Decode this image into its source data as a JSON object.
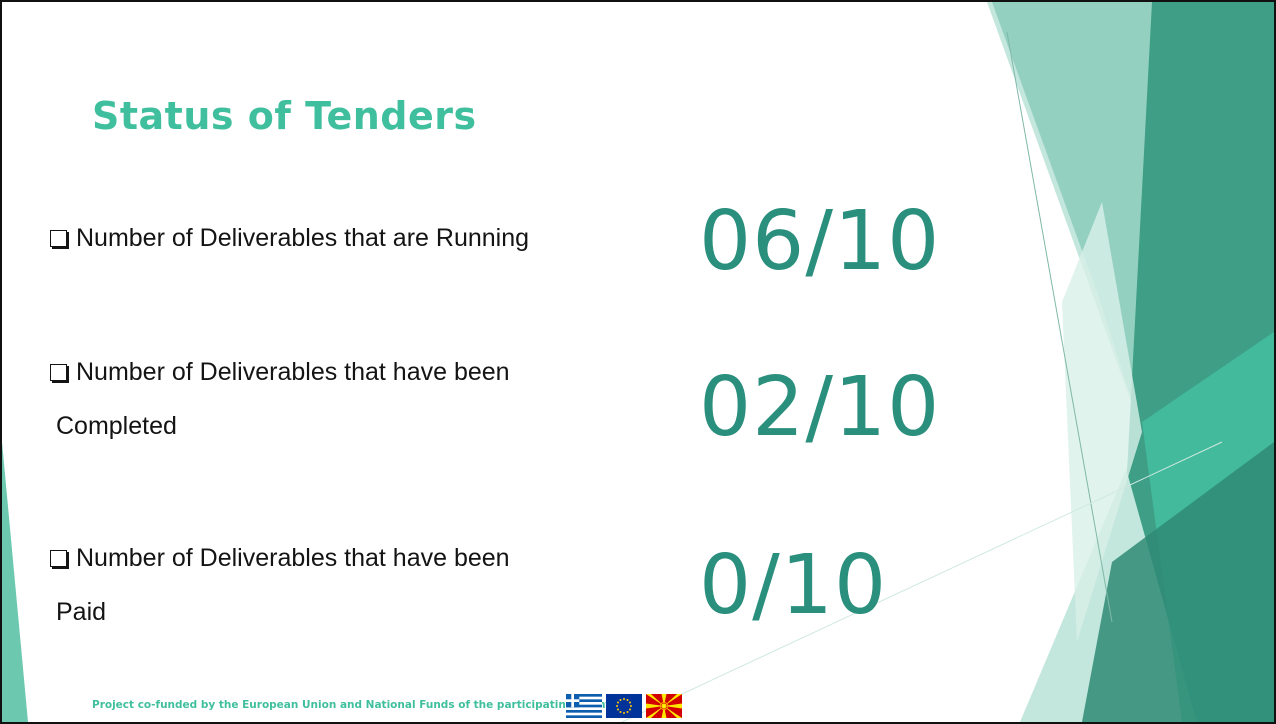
{
  "slide": {
    "title": "Status of Tenders",
    "items": [
      {
        "line1": "Number of Deliverables that are Running",
        "line2": "",
        "value": "06/10"
      },
      {
        "line1": "Number of Deliverables that have been",
        "line2": "Completed",
        "value": "02/10"
      },
      {
        "line1": "Number of Deliverables that have been",
        "line2": "Paid",
        "value": "0/10"
      }
    ],
    "footer": {
      "text": "Project co-funded by the European Union and National Funds of the participating countries",
      "flags": [
        "greece-flag",
        "european-union-flag",
        "north-macedonia-flag"
      ]
    },
    "colors": {
      "title": "#3fbf9d",
      "value": "#2a8f7d",
      "accent_dark": "#2e8f76",
      "accent_mid": "#5ab7a0",
      "accent_light": "#a6dccd"
    }
  }
}
